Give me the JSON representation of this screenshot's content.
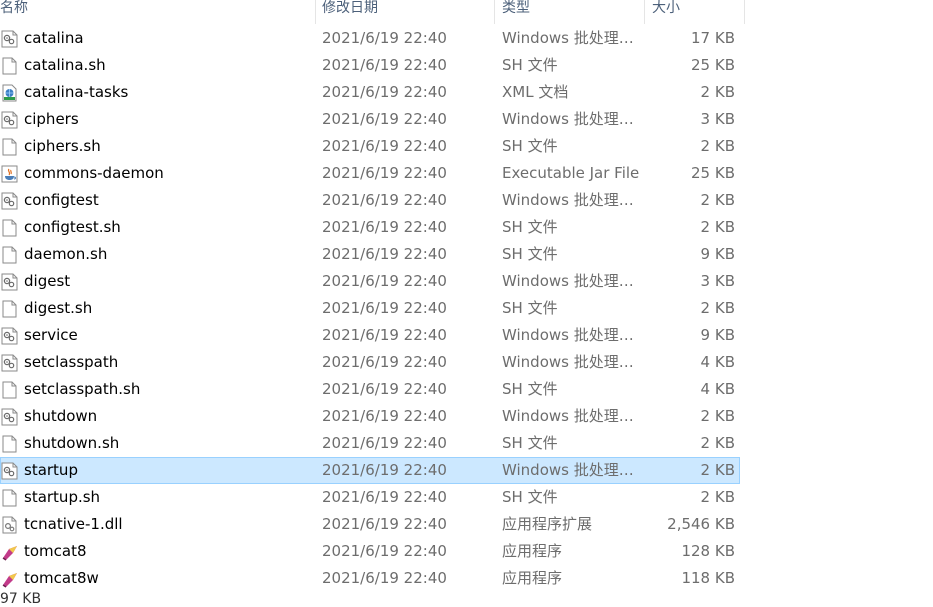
{
  "header": {
    "name": "名称",
    "date": "修改日期",
    "type": "类型",
    "size": "大小"
  },
  "files": [
    {
      "name": "catalina",
      "date": "2021/6/19 22:40",
      "type": "Windows 批处理…",
      "size": "17 KB",
      "icon": "batch-file-icon"
    },
    {
      "name": "catalina.sh",
      "date": "2021/6/19 22:40",
      "type": "SH 文件",
      "size": "25 KB",
      "icon": "blank-file-icon"
    },
    {
      "name": "catalina-tasks",
      "date": "2021/6/19 22:40",
      "type": "XML 文档",
      "size": "2 KB",
      "icon": "xml-file-icon"
    },
    {
      "name": "ciphers",
      "date": "2021/6/19 22:40",
      "type": "Windows 批处理…",
      "size": "3 KB",
      "icon": "batch-file-icon"
    },
    {
      "name": "ciphers.sh",
      "date": "2021/6/19 22:40",
      "type": "SH 文件",
      "size": "2 KB",
      "icon": "blank-file-icon"
    },
    {
      "name": "commons-daemon",
      "date": "2021/6/19 22:40",
      "type": "Executable Jar File",
      "size": "25 KB",
      "icon": "java-jar-icon"
    },
    {
      "name": "configtest",
      "date": "2021/6/19 22:40",
      "type": "Windows 批处理…",
      "size": "2 KB",
      "icon": "batch-file-icon"
    },
    {
      "name": "configtest.sh",
      "date": "2021/6/19 22:40",
      "type": "SH 文件",
      "size": "2 KB",
      "icon": "blank-file-icon"
    },
    {
      "name": "daemon.sh",
      "date": "2021/6/19 22:40",
      "type": "SH 文件",
      "size": "9 KB",
      "icon": "blank-file-icon"
    },
    {
      "name": "digest",
      "date": "2021/6/19 22:40",
      "type": "Windows 批处理…",
      "size": "3 KB",
      "icon": "batch-file-icon"
    },
    {
      "name": "digest.sh",
      "date": "2021/6/19 22:40",
      "type": "SH 文件",
      "size": "2 KB",
      "icon": "blank-file-icon"
    },
    {
      "name": "service",
      "date": "2021/6/19 22:40",
      "type": "Windows 批处理…",
      "size": "9 KB",
      "icon": "batch-file-icon"
    },
    {
      "name": "setclasspath",
      "date": "2021/6/19 22:40",
      "type": "Windows 批处理…",
      "size": "4 KB",
      "icon": "batch-file-icon"
    },
    {
      "name": "setclasspath.sh",
      "date": "2021/6/19 22:40",
      "type": "SH 文件",
      "size": "4 KB",
      "icon": "blank-file-icon"
    },
    {
      "name": "shutdown",
      "date": "2021/6/19 22:40",
      "type": "Windows 批处理…",
      "size": "2 KB",
      "icon": "batch-file-icon"
    },
    {
      "name": "shutdown.sh",
      "date": "2021/6/19 22:40",
      "type": "SH 文件",
      "size": "2 KB",
      "icon": "blank-file-icon"
    },
    {
      "name": "startup",
      "date": "2021/6/19 22:40",
      "type": "Windows 批处理…",
      "size": "2 KB",
      "icon": "batch-file-icon",
      "selected": true
    },
    {
      "name": "startup.sh",
      "date": "2021/6/19 22:40",
      "type": "SH 文件",
      "size": "2 KB",
      "icon": "blank-file-icon"
    },
    {
      "name": "tcnative-1.dll",
      "date": "2021/6/19 22:40",
      "type": "应用程序扩展",
      "size": "2,546 KB",
      "icon": "dll-file-icon"
    },
    {
      "name": "tomcat8",
      "date": "2021/6/19 22:40",
      "type": "应用程序",
      "size": "128 KB",
      "icon": "tomcat-app-icon"
    },
    {
      "name": "tomcat8w",
      "date": "2021/6/19 22:40",
      "type": "应用程序",
      "size": "118 KB",
      "icon": "tomcat-app-icon"
    }
  ],
  "status": {
    "selection_size": "97 KB"
  },
  "colors": {
    "selected_bg": "#cce8ff",
    "selected_border": "#99d1ff",
    "header_text": "#4c607a",
    "meta_text": "#6d6d6d"
  }
}
